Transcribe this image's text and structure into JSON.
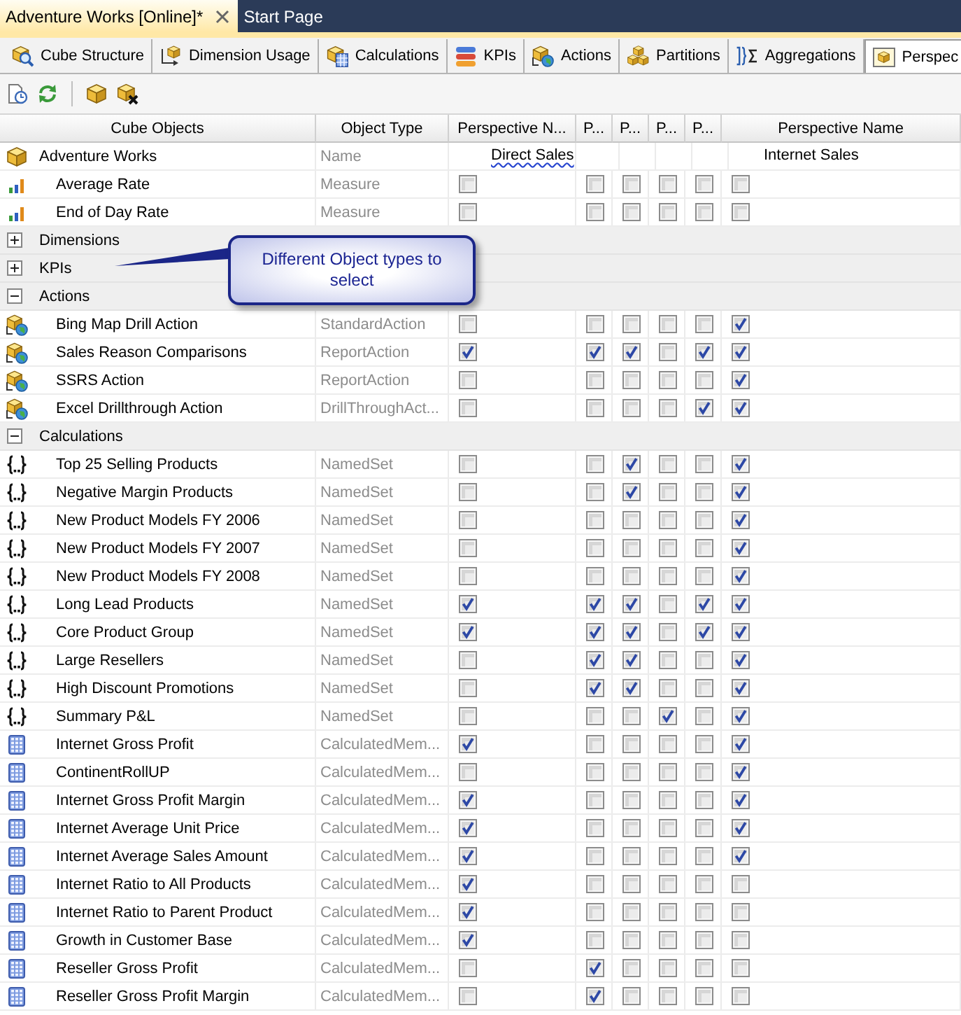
{
  "document_tabs": [
    {
      "label": "Adventure Works [Online]*",
      "selected": true
    },
    {
      "label": "Start Page",
      "selected": false
    }
  ],
  "designer_tabs": [
    {
      "label": "Cube Structure",
      "selected": false
    },
    {
      "label": "Dimension Usage",
      "selected": false
    },
    {
      "label": "Calculations",
      "selected": false
    },
    {
      "label": "KPIs",
      "selected": false
    },
    {
      "label": "Actions",
      "selected": false
    },
    {
      "label": "Partitions",
      "selected": false
    },
    {
      "label": "Aggregations",
      "selected": false
    },
    {
      "label": "Perspec",
      "selected": true
    }
  ],
  "grid": {
    "object_columns": [
      "Cube Objects",
      "Object Type"
    ],
    "perspectives": [
      {
        "header": "Perspective N...",
        "name": "Direct Sales",
        "misspelled": true
      },
      {
        "header": "P..."
      },
      {
        "header": "P..."
      },
      {
        "header": "P..."
      },
      {
        "header": "P..."
      },
      {
        "header": "Perspective Name",
        "name": "Internet Sales",
        "misspelled": false
      }
    ],
    "objects": [
      {
        "kind": "cube",
        "name": "Adventure Works",
        "type": "Name",
        "children": [
          {
            "kind": "measure",
            "name": "Average Rate",
            "type": "Measure",
            "checks": [
              false,
              false,
              false,
              false,
              false,
              false
            ]
          },
          {
            "kind": "measure",
            "name": "End of Day Rate",
            "type": "Measure",
            "checks": [
              false,
              false,
              false,
              false,
              false,
              false
            ]
          }
        ]
      },
      {
        "kind": "folder",
        "name": "Dimensions",
        "expanded": false
      },
      {
        "kind": "folder",
        "name": "KPIs",
        "expanded": false
      },
      {
        "kind": "folder",
        "name": "Actions",
        "expanded": true,
        "children": [
          {
            "kind": "action",
            "name": "Bing Map Drill Action",
            "type": "StandardAction",
            "checks": [
              false,
              false,
              false,
              false,
              false,
              true
            ]
          },
          {
            "kind": "action",
            "name": "Sales Reason Comparisons",
            "type": "ReportAction",
            "checks": [
              true,
              true,
              true,
              false,
              true,
              true
            ]
          },
          {
            "kind": "action",
            "name": "SSRS Action",
            "type": "ReportAction",
            "checks": [
              false,
              false,
              false,
              false,
              false,
              true
            ]
          },
          {
            "kind": "action",
            "name": "Excel Drillthrough Action",
            "type": "DrillThroughAct...",
            "checks": [
              false,
              false,
              false,
              false,
              true,
              true
            ]
          }
        ]
      },
      {
        "kind": "folder",
        "name": "Calculations",
        "expanded": true,
        "children": [
          {
            "kind": "named_set",
            "name": "Top 25 Selling Products",
            "type": "NamedSet",
            "checks": [
              false,
              false,
              true,
              false,
              false,
              true
            ]
          },
          {
            "kind": "named_set",
            "name": "Negative Margin Products",
            "type": "NamedSet",
            "checks": [
              false,
              false,
              true,
              false,
              false,
              true
            ]
          },
          {
            "kind": "named_set",
            "name": "New Product Models FY 2006",
            "type": "NamedSet",
            "checks": [
              false,
              false,
              false,
              false,
              false,
              true
            ]
          },
          {
            "kind": "named_set",
            "name": "New Product Models FY 2007",
            "type": "NamedSet",
            "checks": [
              false,
              false,
              false,
              false,
              false,
              true
            ]
          },
          {
            "kind": "named_set",
            "name": "New Product Models FY 2008",
            "type": "NamedSet",
            "checks": [
              false,
              false,
              false,
              false,
              false,
              true
            ]
          },
          {
            "kind": "named_set",
            "name": "Long Lead Products",
            "type": "NamedSet",
            "checks": [
              true,
              true,
              true,
              false,
              true,
              true
            ]
          },
          {
            "kind": "named_set",
            "name": "Core Product Group",
            "type": "NamedSet",
            "checks": [
              true,
              true,
              true,
              false,
              true,
              true
            ]
          },
          {
            "kind": "named_set",
            "name": "Large Resellers",
            "type": "NamedSet",
            "checks": [
              false,
              true,
              true,
              false,
              false,
              true
            ]
          },
          {
            "kind": "named_set",
            "name": "High Discount Promotions",
            "type": "NamedSet",
            "checks": [
              false,
              true,
              true,
              false,
              false,
              true
            ]
          },
          {
            "kind": "named_set",
            "name": "Summary P&L",
            "type": "NamedSet",
            "checks": [
              false,
              false,
              false,
              true,
              false,
              true
            ]
          },
          {
            "kind": "calculated_member",
            "name": "Internet Gross Profit",
            "type": "CalculatedMem...",
            "checks": [
              true,
              false,
              false,
              false,
              false,
              true
            ]
          },
          {
            "kind": "calculated_member",
            "name": "ContinentRollUP",
            "type": "CalculatedMem...",
            "checks": [
              false,
              false,
              false,
              false,
              false,
              true
            ]
          },
          {
            "kind": "calculated_member",
            "name": "Internet Gross Profit Margin",
            "type": "CalculatedMem...",
            "checks": [
              true,
              false,
              false,
              false,
              false,
              true
            ]
          },
          {
            "kind": "calculated_member",
            "name": "Internet Average Unit Price",
            "type": "CalculatedMem...",
            "checks": [
              true,
              false,
              false,
              false,
              false,
              true
            ]
          },
          {
            "kind": "calculated_member",
            "name": "Internet Average Sales Amount",
            "type": "CalculatedMem...",
            "checks": [
              true,
              false,
              false,
              false,
              false,
              true
            ]
          },
          {
            "kind": "calculated_member",
            "name": "Internet Ratio to All Products",
            "type": "CalculatedMem...",
            "checks": [
              true,
              false,
              false,
              false,
              false,
              false
            ]
          },
          {
            "kind": "calculated_member",
            "name": "Internet Ratio to Parent Product",
            "type": "CalculatedMem...",
            "checks": [
              true,
              false,
              false,
              false,
              false,
              false
            ]
          },
          {
            "kind": "calculated_member",
            "name": "Growth in Customer Base",
            "type": "CalculatedMem...",
            "checks": [
              true,
              false,
              false,
              false,
              false,
              false
            ]
          },
          {
            "kind": "calculated_member",
            "name": "Reseller Gross Profit",
            "type": "CalculatedMem...",
            "checks": [
              false,
              true,
              false,
              false,
              false,
              false
            ]
          },
          {
            "kind": "calculated_member",
            "name": "Reseller Gross Profit Margin",
            "type": "CalculatedMem...",
            "checks": [
              false,
              true,
              false,
              false,
              false,
              false
            ]
          }
        ]
      }
    ]
  },
  "callout": {
    "text": "Different Object types to select"
  }
}
